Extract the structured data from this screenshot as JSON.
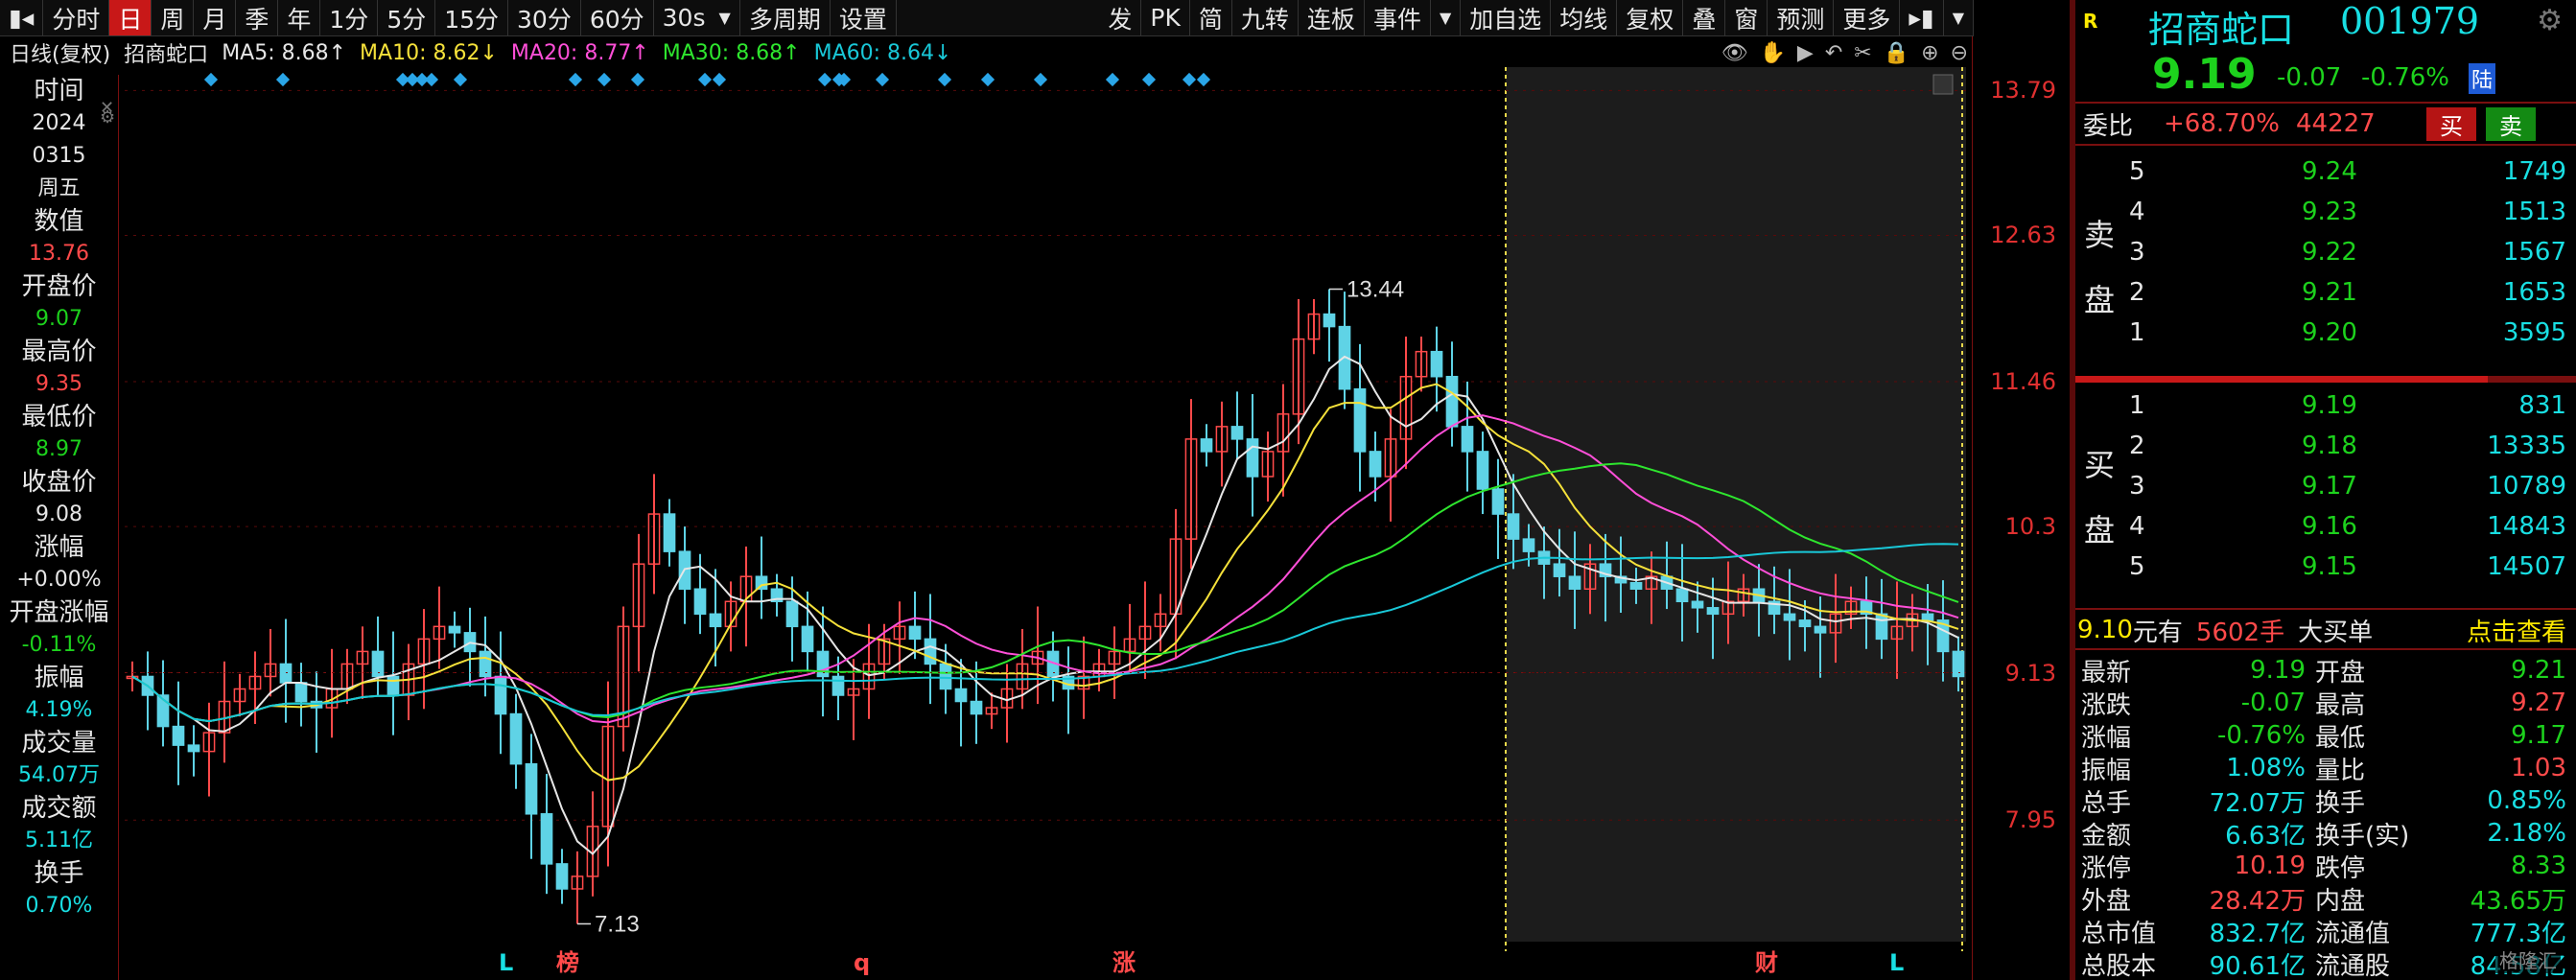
{
  "toolbar": {
    "left_items": [
      "分时",
      "日",
      "周",
      "月",
      "季",
      "年",
      "1分",
      "5分",
      "15分",
      "30分",
      "60分",
      "30s",
      "多周期",
      "设置"
    ],
    "active": "日",
    "right_items": [
      "发",
      "PK",
      "简",
      "九转",
      "连板",
      "事件",
      "加自选",
      "均线",
      "复权",
      "叠",
      "窗",
      "预测",
      "更多"
    ]
  },
  "ma_bar": {
    "label": "日线(复权)",
    "stock": "招商蛇口",
    "ma5": "MA5: 8.68↑",
    "ma10": "MA10: 8.62↓",
    "ma20": "MA20: 8.77↑",
    "ma30": "MA30: 8.68↑",
    "ma60": "MA60: 8.64↓",
    "colors": {
      "ma5": "#e6e6e6",
      "ma10": "#f5e13a",
      "ma20": "#ff4fd8",
      "ma30": "#2ee62e",
      "ma60": "#19c8d8"
    }
  },
  "left_info": [
    {
      "label": "时间",
      "values": [
        "2024",
        "0315",
        "周五"
      ],
      "color": "#e6e6e6"
    },
    {
      "label": "数值",
      "values": [
        "13.76"
      ],
      "color": "#ff4a4a"
    },
    {
      "label": "开盘价",
      "values": [
        "9.07"
      ],
      "color": "#1dd21d"
    },
    {
      "label": "最高价",
      "values": [
        "9.35"
      ],
      "color": "#ff4a4a"
    },
    {
      "label": "最低价",
      "values": [
        "8.97"
      ],
      "color": "#1dd21d"
    },
    {
      "label": "收盘价",
      "values": [
        "9.08"
      ],
      "color": "#e6e6e6"
    },
    {
      "label": "涨幅",
      "values": [
        "+0.00%"
      ],
      "color": "#e6e6e6"
    },
    {
      "label": "开盘涨幅",
      "values": [
        "-0.11%"
      ],
      "color": "#1dd21d"
    },
    {
      "label": "振幅",
      "values": [
        "4.19%"
      ],
      "color": "#19dfe3"
    },
    {
      "label": "成交量",
      "values": [
        "54.07万"
      ],
      "color": "#19dfe3"
    },
    {
      "label": "成交额",
      "values": [
        "5.11亿"
      ],
      "color": "#19dfe3"
    },
    {
      "label": "换手",
      "values": [
        "0.70%"
      ],
      "color": "#19dfe3"
    }
  ],
  "chart_data": {
    "type": "candlestick",
    "y_ticks": [
      13.79,
      12.63,
      11.46,
      10.3,
      9.13,
      7.95
    ],
    "ylim": [
      7.3,
      13.9
    ],
    "annotations": [
      {
        "text": "13.44",
        "type": "high"
      },
      {
        "text": "7.13",
        "type": "low"
      }
    ],
    "bottom_markers": [
      {
        "text": "L",
        "color": "#19dfe3"
      },
      {
        "text": "榜",
        "color": "#ff4a4a"
      },
      {
        "text": "q",
        "color": "#ff4a4a"
      },
      {
        "text": "涨",
        "color": "#ff4a4a"
      },
      {
        "text": "财",
        "color": "#ff4a4a"
      },
      {
        "text": "L",
        "color": "#19dfe3"
      }
    ],
    "closes": [
      9.1,
      8.95,
      8.7,
      8.55,
      8.5,
      8.65,
      8.9,
      9.0,
      9.1,
      9.2,
      9.05,
      8.9,
      8.85,
      9.0,
      9.2,
      9.3,
      9.1,
      8.95,
      9.2,
      9.4,
      9.5,
      9.45,
      9.3,
      9.1,
      8.8,
      8.4,
      8.0,
      7.6,
      7.4,
      7.5,
      7.9,
      8.7,
      9.5,
      10.0,
      10.4,
      10.1,
      9.8,
      9.6,
      9.5,
      9.7,
      9.9,
      9.8,
      9.7,
      9.5,
      9.3,
      9.1,
      8.95,
      9.0,
      9.2,
      9.4,
      9.5,
      9.4,
      9.2,
      9.0,
      8.9,
      8.8,
      8.85,
      9.0,
      9.2,
      9.3,
      9.1,
      9.0,
      9.1,
      9.2,
      9.3,
      9.4,
      9.5,
      9.6,
      10.2,
      11.0,
      10.9,
      11.1,
      11.0,
      10.7,
      10.9,
      11.2,
      11.8,
      12.0,
      11.9,
      11.4,
      10.9,
      10.7,
      11.0,
      11.5,
      11.7,
      11.5,
      11.1,
      10.9,
      10.6,
      10.4,
      10.2,
      10.1,
      10.0,
      9.9,
      9.8,
      10.0,
      9.9,
      9.85,
      9.8,
      9.9,
      9.8,
      9.7,
      9.65,
      9.6,
      9.7,
      9.8,
      9.7,
      9.6,
      9.55,
      9.5,
      9.45,
      9.6,
      9.7,
      9.6,
      9.4,
      9.5,
      9.6,
      9.55,
      9.3,
      9.1
    ],
    "highlight_start_index": 90,
    "last_price_line": 9.13
  },
  "quote": {
    "badge": "R",
    "name": "招商蛇口",
    "code": "001979",
    "price": "9.19",
    "change": "-0.07",
    "change_pct": "-0.76%",
    "lu_tag": "陆",
    "webi_label": "委比",
    "webi_pct": "+68.70%",
    "webi_vol": "44227",
    "buy_btn": "买",
    "sell_btn": "卖",
    "sell_label": [
      "卖",
      "盘"
    ],
    "buy_label": [
      "买",
      "盘"
    ],
    "asks": [
      {
        "level": "5",
        "price": "9.24",
        "vol": "1749"
      },
      {
        "level": "4",
        "price": "9.23",
        "vol": "1513"
      },
      {
        "level": "3",
        "price": "9.22",
        "vol": "1567"
      },
      {
        "level": "2",
        "price": "9.21",
        "vol": "1653"
      },
      {
        "level": "1",
        "price": "9.20",
        "vol": "3595"
      }
    ],
    "bids": [
      {
        "level": "1",
        "price": "9.19",
        "vol": "831"
      },
      {
        "level": "2",
        "price": "9.18",
        "vol": "13335"
      },
      {
        "level": "3",
        "price": "9.17",
        "vol": "10789"
      },
      {
        "level": "4",
        "price": "9.16",
        "vol": "14843"
      },
      {
        "level": "5",
        "price": "9.15",
        "vol": "14507"
      }
    ],
    "big_order": {
      "price": "9.10",
      "unit": "元有",
      "vol": "5602手",
      "label": "大买单",
      "link": "点击查看"
    },
    "stats": [
      [
        "最新",
        "9.19",
        "green",
        "开盘",
        "9.21",
        "green"
      ],
      [
        "涨跌",
        "-0.07",
        "green",
        "最高",
        "9.27",
        "red"
      ],
      [
        "涨幅",
        "-0.76%",
        "green",
        "最低",
        "9.17",
        "green"
      ],
      [
        "振幅",
        "1.08%",
        "cyan",
        "量比",
        "1.03",
        "red"
      ],
      [
        "总手",
        "72.07万",
        "cyan",
        "换手",
        "0.85%",
        "cyan"
      ],
      [
        "金额",
        "6.63亿",
        "cyan",
        "换手(实)",
        "2.18%",
        "cyan"
      ],
      [
        "涨停",
        "10.19",
        "red",
        "跌停",
        "8.33",
        "green"
      ],
      [
        "外盘",
        "28.42万",
        "red",
        "内盘",
        "43.65万",
        "green"
      ],
      [
        "总市值",
        "832.7亿",
        "cyan",
        "流通值",
        "777.3亿",
        "cyan"
      ],
      [
        "总股本",
        "90.61亿",
        "cyan",
        "流通股",
        "84.58亿",
        "cyan"
      ]
    ],
    "watermark": "格隆汇"
  }
}
